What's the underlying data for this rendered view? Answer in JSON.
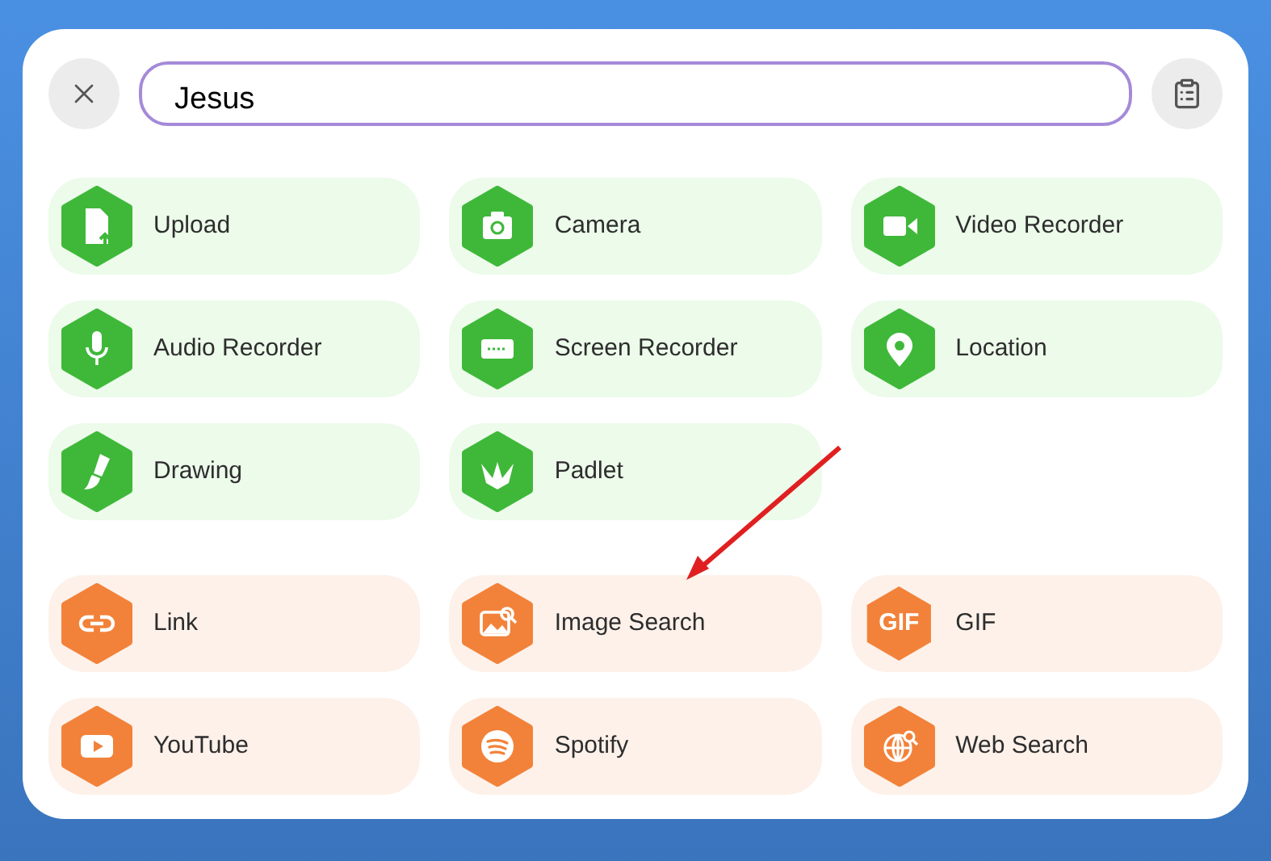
{
  "search": {
    "value": "Jesus"
  },
  "groups": [
    {
      "kind": "create",
      "items": [
        {
          "label": "Upload"
        },
        {
          "label": "Camera"
        },
        {
          "label": "Video Recorder"
        },
        {
          "label": "Audio Recorder"
        },
        {
          "label": "Screen Recorder"
        },
        {
          "label": "Location"
        },
        {
          "label": "Drawing"
        },
        {
          "label": "Padlet"
        }
      ]
    },
    {
      "kind": "attach",
      "items": [
        {
          "label": "Link"
        },
        {
          "label": "Image Search"
        },
        {
          "label": "GIF",
          "icon_text": "GIF"
        },
        {
          "label": "YouTube"
        },
        {
          "label": "Spotify"
        },
        {
          "label": "Web Search"
        }
      ]
    }
  ]
}
